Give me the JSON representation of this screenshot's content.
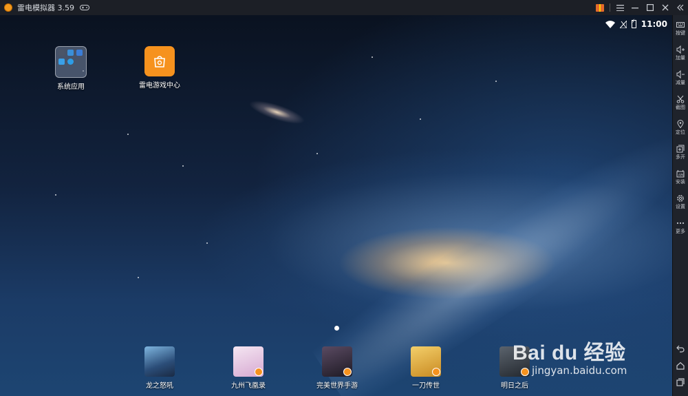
{
  "window": {
    "title": "雷电模拟器 3.59",
    "controls": [
      "gift-icon",
      "menu-icon",
      "minimize-icon",
      "maximize-icon",
      "close-icon",
      "collapse-icon"
    ]
  },
  "statusbar": {
    "time": "11:00"
  },
  "desktop": {
    "icons": [
      {
        "label": "系统应用",
        "icon": "folder-icon"
      },
      {
        "label": "雷电游戏中心",
        "icon": "game-center-icon"
      }
    ]
  },
  "dock": [
    {
      "label": "龙之怒吼",
      "icon": "game-icon",
      "color": "#3a5f8a"
    },
    {
      "label": "九州飞凰录",
      "icon": "game-icon",
      "color": "#e8c9e4"
    },
    {
      "label": "完美世界手游",
      "icon": "game-icon",
      "color": "#2a2430"
    },
    {
      "label": "一刀传世",
      "icon": "game-icon",
      "color": "#d9a42a"
    },
    {
      "label": "明日之后",
      "icon": "game-icon",
      "color": "#2b3138"
    }
  ],
  "sidebar": {
    "items": [
      {
        "label": "按键",
        "icon": "keyboard-icon"
      },
      {
        "label": "加量",
        "icon": "volume-up-icon"
      },
      {
        "label": "减量",
        "icon": "volume-down-icon"
      },
      {
        "label": "截图",
        "icon": "scissors-icon"
      },
      {
        "label": "定位",
        "icon": "location-icon"
      },
      {
        "label": "多开",
        "icon": "multi-instance-icon"
      },
      {
        "label": "安装",
        "icon": "install-apk-icon"
      },
      {
        "label": "设置",
        "icon": "gear-icon"
      },
      {
        "label": "更多",
        "icon": "more-icon"
      }
    ],
    "bottom": [
      "back-icon",
      "home-icon",
      "recent-apps-icon"
    ]
  },
  "watermark": {
    "brand": "Bai  du 经验",
    "url": "jingyan.baidu.com"
  }
}
